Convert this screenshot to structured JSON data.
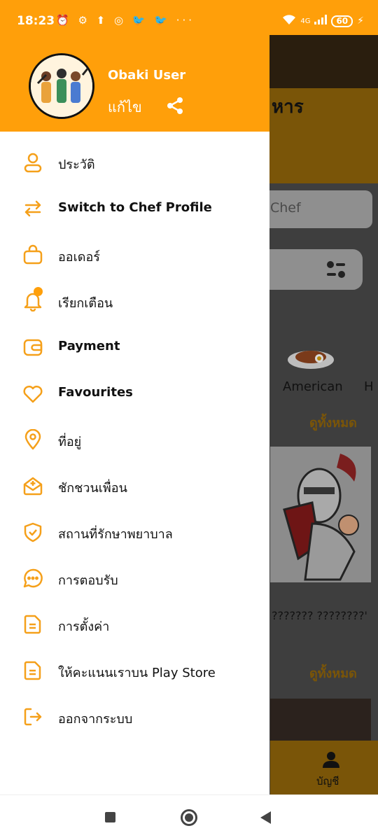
{
  "status_bar": {
    "time": "18:23",
    "notification_icons": "⏰ ⚙ ⬆ ◎ 🐦 🐦 ···",
    "network": "4G",
    "battery": "60",
    "charging": "⚡"
  },
  "drawer": {
    "user_name": "Obaki User",
    "edit_label": "แก้ไข",
    "accent_color": "#ff9f0a",
    "menu": [
      {
        "label": "ประวัติ",
        "icon": "user-icon",
        "bold": false
      },
      {
        "label": "Switch to Chef Profile",
        "icon": "switch-arrows-icon",
        "bold": true
      },
      {
        "label": "ออเดอร์",
        "icon": "shopping-bag-icon",
        "bold": false
      },
      {
        "label": "เรียกเตือน",
        "icon": "bell-icon",
        "bold": false
      },
      {
        "label": "Payment",
        "icon": "wallet-icon",
        "bold": true
      },
      {
        "label": "Favourites",
        "icon": "heart-icon",
        "bold": true
      },
      {
        "label": "ที่อยู่",
        "icon": "location-pin-icon",
        "bold": false
      },
      {
        "label": "ชักชวนเพื่อน",
        "icon": "invite-mail-icon",
        "bold": false
      },
      {
        "label": "สถานที่รักษาพยาบาล",
        "icon": "shield-check-icon",
        "bold": false
      },
      {
        "label": "การตอบรับ",
        "icon": "chat-bubble-icon",
        "bold": false
      },
      {
        "label": "การตั้งค่า",
        "icon": "document-icon",
        "bold": false
      },
      {
        "label": "ให้คะแนนเราบน Play Store",
        "icon": "document-icon",
        "bold": false
      },
      {
        "label": "ออกจากระบบ",
        "icon": "logout-icon",
        "bold": false
      }
    ]
  },
  "background": {
    "title_fragment": "หาร",
    "search_placeholder_fragment": "Chef",
    "category_american": "American",
    "category_next_fragment": "H",
    "see_all_1": "ดูทั้งหมด",
    "see_all_2": "ดูทั้งหมด",
    "card_title_fragment": "??????? ????????'",
    "bottom_nav_account": "บัญชี"
  }
}
